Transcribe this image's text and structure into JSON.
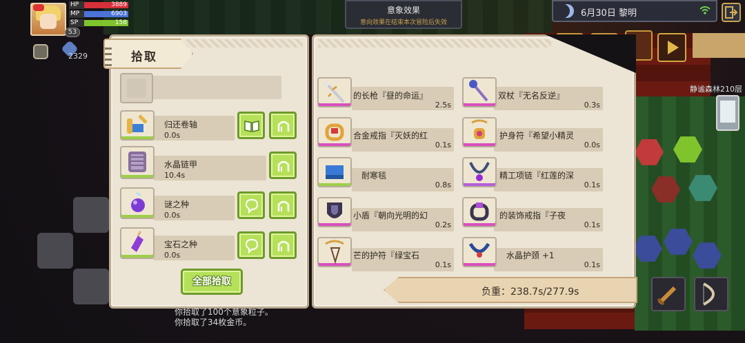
{
  "hud": {
    "hp": {
      "label": "HP",
      "value": "3889"
    },
    "mp": {
      "label": "MP",
      "value": "6903"
    },
    "sp": {
      "label": "SP",
      "value": "158"
    },
    "level": "53",
    "currency_count": "2329",
    "colors": {
      "hp": "#d6303a",
      "mp": "#4b73d8",
      "sp": "#7fc42d"
    }
  },
  "buff_banner": {
    "title": "意象效果",
    "subtitle": "意向效果在结束本次冒险后失效"
  },
  "date": {
    "text": "6月30日  黎明"
  },
  "area_name": "静谧森林210层",
  "pickup_panel": {
    "title": "拾取",
    "items": [
      {
        "name": "归还卷轴",
        "weight": "0.0s",
        "icon": "scroll-icon",
        "rarity_color": "#9dcf4a",
        "actions": [
          "read-icon",
          "grab-icon"
        ]
      },
      {
        "name": "水晶链甲",
        "weight": "10.4s",
        "icon": "chainmail-icon",
        "rarity_color": "#9dcf4a",
        "actions": [
          "grab-icon"
        ]
      },
      {
        "name": "谜之种",
        "weight": "0.0s",
        "icon": "seed-icon",
        "rarity_color": "#9dcf4a",
        "actions": [
          "plant-icon",
          "grab-icon"
        ]
      },
      {
        "name": "宝石之种",
        "weight": "0.0s",
        "icon": "gem-seed-icon",
        "rarity_color": "#9dcf4a",
        "actions": [
          "plant-icon",
          "grab-icon"
        ]
      }
    ],
    "pick_all_label": "全部拾取"
  },
  "loot_panel": {
    "left_column": [
      {
        "name": "的长枪『昼的命运』",
        "weight": "2.5s",
        "icon": "spear-icon",
        "rarity_color": "#d84fbd"
      },
      {
        "name": "合金戒指『灭妖的红",
        "weight": "0.1s",
        "icon": "ring-icon",
        "rarity_color": "#d84fbd"
      },
      {
        "name": "耐寒毯",
        "weight": "0.8s",
        "icon": "blanket-icon",
        "rarity_color": "#9dcf4a"
      },
      {
        "name": "小盾『朝向光明的幻",
        "weight": "0.2s",
        "icon": "shield-icon",
        "rarity_color": "#d84fbd"
      },
      {
        "name": "芒的护符『绿宝石",
        "weight": "0.1s",
        "icon": "amulet-icon",
        "rarity_color": "#d84fbd"
      }
    ],
    "right_column": [
      {
        "name": "双杖『无名反逆』",
        "weight": "0.3s",
        "icon": "staff-icon",
        "rarity_color": "#d84fbd"
      },
      {
        "name": "护身符『希望小精灵",
        "weight": "0.0s",
        "icon": "charm-icon",
        "rarity_color": "#d84fbd"
      },
      {
        "name": "精工项链『红莲的深",
        "weight": "0.1s",
        "icon": "necklace-icon",
        "rarity_color": "#b45fd8"
      },
      {
        "name": "的装饰戒指『子夜",
        "weight": "0.1s",
        "icon": "decor-ring-icon",
        "rarity_color": "#d84fbd"
      },
      {
        "name": "水晶护颈 +1",
        "weight": "0.1s",
        "icon": "gorget-icon",
        "rarity_color": "#d84fbd"
      }
    ],
    "weight_summary": "负重：238.7s/277.9s"
  },
  "log": {
    "line1": "你拾取了100个意象粒子。",
    "line2": "你拾取了34枚金币。"
  }
}
